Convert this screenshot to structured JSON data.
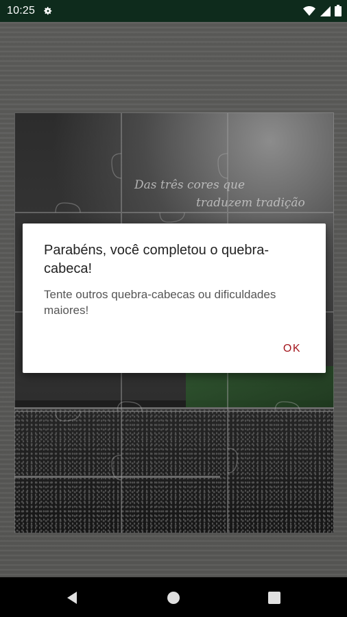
{
  "status_bar": {
    "time": "10:25"
  },
  "puzzle": {
    "motto_line1": "Das três cores que",
    "motto_line2": "traduzem tradição"
  },
  "dialog": {
    "title": "Parabéns, você completou o quebra-cabeca!",
    "message": "Tente outros quebra-cabecas ou dificuldades maiores!",
    "ok_label": "OK"
  },
  "colors": {
    "status_bar_bg": "#0e2b1c",
    "accent": "#a3141b",
    "dialog_bg": "#ffffff"
  },
  "icons": [
    "gear-icon",
    "wifi-icon",
    "signal-icon",
    "battery-icon",
    "back-icon",
    "home-icon",
    "recents-icon"
  ]
}
